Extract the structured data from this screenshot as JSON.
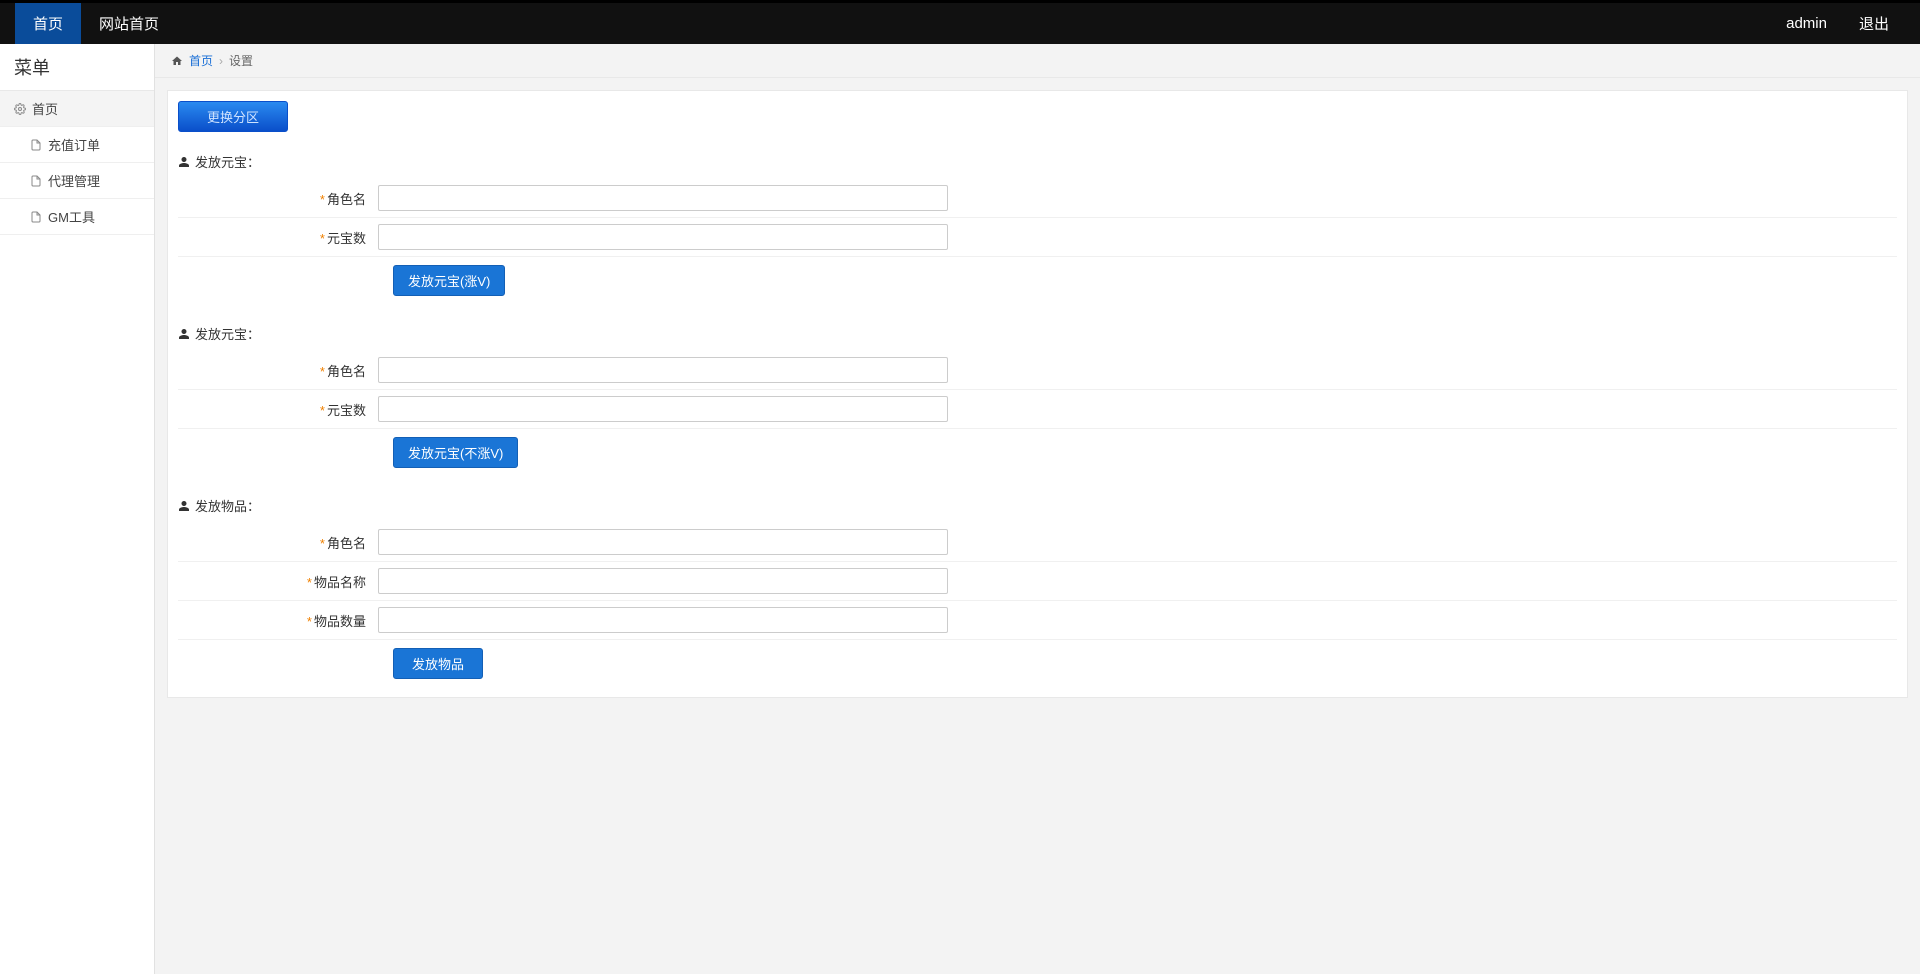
{
  "topbar": {
    "nav": [
      {
        "label": "首页",
        "active": true
      },
      {
        "label": "网站首页",
        "active": false
      }
    ],
    "user": "admin",
    "logout": "退出"
  },
  "sidebar": {
    "title": "菜单",
    "items": [
      {
        "label": "首页",
        "icon": "gear",
        "level": 0
      },
      {
        "label": "充值订单",
        "icon": "file",
        "level": 1
      },
      {
        "label": "代理管理",
        "icon": "file",
        "level": 1
      },
      {
        "label": "GM工具",
        "icon": "file",
        "level": 1
      }
    ]
  },
  "breadcrumb": {
    "home_link": "首页",
    "current": "设置"
  },
  "panel": {
    "zone_button": "更换分区",
    "sections": [
      {
        "title": "发放元宝：",
        "fields": [
          {
            "label": "角色名"
          },
          {
            "label": "元宝数"
          }
        ],
        "action": "发放元宝(涨V)"
      },
      {
        "title": "发放元宝：",
        "fields": [
          {
            "label": "角色名"
          },
          {
            "label": "元宝数"
          }
        ],
        "action": "发放元宝(不涨V)"
      },
      {
        "title": "发放物品：",
        "fields": [
          {
            "label": "角色名"
          },
          {
            "label": "物品名称"
          },
          {
            "label": "物品数量"
          }
        ],
        "action": "发放物品"
      }
    ]
  }
}
